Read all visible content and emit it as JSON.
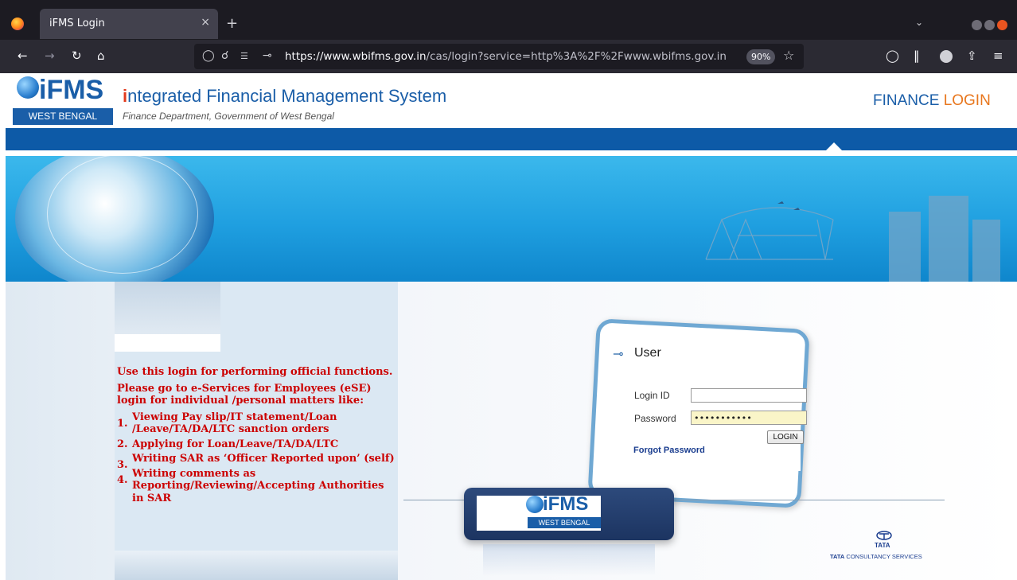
{
  "browser": {
    "tab_title": "iFMS Login",
    "tab_close": "×",
    "new_tab": "+",
    "url_domain": "https://www.wbifms.gov.in",
    "url_path": "/cas/login?service=http%3A%2F%2Fwww.wbifms.gov.in",
    "zoom": "90%"
  },
  "header": {
    "logo_text": "iFMS",
    "logo_region": "WEST BENGAL",
    "system_title_first": "i",
    "system_title_rest": "ntegrated Financial Management System",
    "subtitle": "Finance Department, Government of West Bengal",
    "finance": "FINANCE",
    "login": "LOGIN"
  },
  "notice": {
    "line1": "Use this login for performing official functions.",
    "line2": "Please go to e-Services for Employees (eSE) login for individual /personal matters like:",
    "items": [
      {
        "num": "1.",
        "text": "Viewing Pay slip/IT statement/Loan /Leave/TA/DA/LTC sanction orders"
      },
      {
        "num": "2.",
        "text": "Applying for Loan/Leave/TA/DA/LTC"
      },
      {
        "num": "3.",
        "text": "Writing SAR as ‘Officer Reported upon’ (self)"
      },
      {
        "num": "4.",
        "text": "Writing comments as Reporting/Reviewing/Accepting Authorities in SAR"
      }
    ]
  },
  "login": {
    "heading": "User",
    "login_id_label": "Login ID",
    "login_id_value": "",
    "password_label": "Password",
    "password_value": "•••••••••••",
    "button": "LOGIN",
    "forgot": "Forgot Password"
  },
  "footer": {
    "logo_text": "iFMS",
    "logo_region": "WEST BENGAL",
    "tata": "TATA",
    "tcs_bold": "TATA",
    "tcs_rest": " CONSULTANCY SERVICES"
  },
  "colors": {
    "brand_blue": "#1a5ea8",
    "accent_orange": "#e8771e",
    "notice_red": "#cc0000",
    "nav_strip": "#0d5aa7"
  }
}
